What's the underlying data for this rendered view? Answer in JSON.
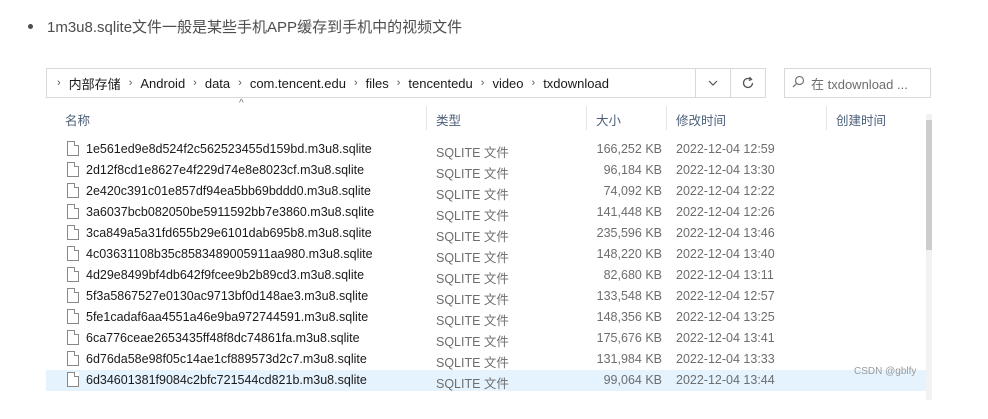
{
  "bullet_text": "1m3u8.sqlite文件一般是某些手机APP缓存到手机中的视频文件",
  "breadcrumb": [
    "内部存储",
    "Android",
    "data",
    "com.tencent.edu",
    "files",
    "tencentedu",
    "video",
    "txdownload"
  ],
  "address_dropdown_icon": "chevron-down-icon",
  "refresh_icon": "refresh-icon",
  "search": {
    "icon": "search-icon",
    "placeholder": "在 txdownload ..."
  },
  "columns": {
    "name": "名称",
    "type": "类型",
    "size": "大小",
    "modified": "修改时间",
    "created": "创建时间"
  },
  "sort_indicator": "^",
  "files": [
    {
      "name": "1e561ed9e8d524f2c562523455d159bd.m3u8.sqlite",
      "type": "SQLITE 文件",
      "size": "166,252 KB",
      "modified": "2022-12-04 12:59"
    },
    {
      "name": "2d12f8cd1e8627e4f229d74e8e8023cf.m3u8.sqlite",
      "type": "SQLITE 文件",
      "size": "96,184 KB",
      "modified": "2022-12-04 13:30"
    },
    {
      "name": "2e420c391c01e857df94ea5bb69bddd0.m3u8.sqlite",
      "type": "SQLITE 文件",
      "size": "74,092 KB",
      "modified": "2022-12-04 12:22"
    },
    {
      "name": "3a6037bcb082050be5911592bb7e3860.m3u8.sqlite",
      "type": "SQLITE 文件",
      "size": "141,448 KB",
      "modified": "2022-12-04 12:26"
    },
    {
      "name": "3ca849a5a31fd655b29e6101dab695b8.m3u8.sqlite",
      "type": "SQLITE 文件",
      "size": "235,596 KB",
      "modified": "2022-12-04 13:46"
    },
    {
      "name": "4c03631108b35c8583489005911aa980.m3u8.sqlite",
      "type": "SQLITE 文件",
      "size": "148,220 KB",
      "modified": "2022-12-04 13:40"
    },
    {
      "name": "4d29e8499bf4db642f9fcee9b2b89cd3.m3u8.sqlite",
      "type": "SQLITE 文件",
      "size": "82,680 KB",
      "modified": "2022-12-04 13:11"
    },
    {
      "name": "5f3a5867527e0130ac9713bf0d148ae3.m3u8.sqlite",
      "type": "SQLITE 文件",
      "size": "133,548 KB",
      "modified": "2022-12-04 12:57"
    },
    {
      "name": "5fe1cadaf6aa4551a46e9ba972744591.m3u8.sqlite",
      "type": "SQLITE 文件",
      "size": "148,356 KB",
      "modified": "2022-12-04 13:25"
    },
    {
      "name": "6ca776ceae2653435ff48f8dc74861fa.m3u8.sqlite",
      "type": "SQLITE 文件",
      "size": "175,676 KB",
      "modified": "2022-12-04 13:41"
    },
    {
      "name": "6d76da58e98f05c14ae1cf889573d2c7.m3u8.sqlite",
      "type": "SQLITE 文件",
      "size": "131,984 KB",
      "modified": "2022-12-04 13:33"
    },
    {
      "name": "6d34601381f9084c2bfc721544cd821b.m3u8.sqlite",
      "type": "SQLITE 文件",
      "size": "99,064 KB",
      "modified": "2022-12-04 13:44",
      "selected": true
    }
  ],
  "watermark": "CSDN @gblfy",
  "colors": {
    "selected_row": "#e5f3ff",
    "header_text": "#4c607a"
  }
}
